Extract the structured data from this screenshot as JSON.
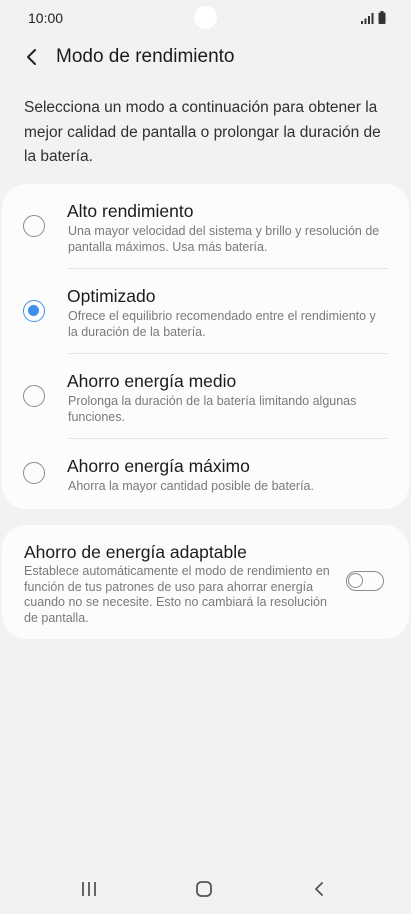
{
  "status_bar": {
    "time": "10:00",
    "icons": [
      "signal-icon",
      "battery-icon"
    ]
  },
  "header": {
    "title": "Modo de rendimiento",
    "back_icon": "chevron-left-icon"
  },
  "intro": "Selecciona un modo a continuación para obtener la mejor calidad de pantalla o prolongar la duración de la batería.",
  "modes": [
    {
      "title": "Alto rendimiento",
      "description": "Una mayor velocidad del sistema y brillo y resolución de pantalla máximos. Usa más batería.",
      "selected": false
    },
    {
      "title": "Optimizado",
      "description": "Ofrece el equilibrio recomendado entre el rendimiento y la duración de la batería.",
      "selected": true
    },
    {
      "title": "Ahorro energía medio",
      "description": "Prolonga la duración de la batería limitando algunas funciones.",
      "selected": false
    },
    {
      "title": "Ahorro energía máximo",
      "description": "Ahorra la mayor cantidad posible de batería.",
      "selected": false
    }
  ],
  "adaptive": {
    "title": "Ahorro de energía adaptable",
    "description": "Establece automáticamente el modo de rendimiento en función de tus patrones de uso para ahorrar energía cuando no se necesite. Esto no cambiará la resolución de pantalla.",
    "enabled": false
  },
  "nav_bar": {
    "buttons": [
      "recents-icon",
      "home-icon",
      "back-icon"
    ]
  },
  "colors": {
    "accent": "#3e91ea",
    "background": "#f2f2f2",
    "card": "#fcfcfc"
  }
}
